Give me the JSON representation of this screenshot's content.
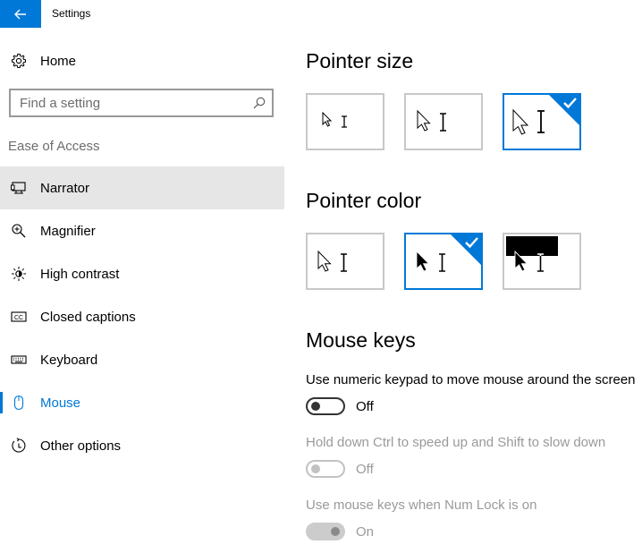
{
  "window": {
    "title": "Settings"
  },
  "colors": {
    "accent": "#0078d7",
    "hover_bg": "#e6e6e6",
    "disabled_text": "#9a9a9a"
  },
  "sidebar": {
    "home_label": "Home",
    "home_icon": "gear-icon",
    "search_placeholder": "Find a setting",
    "search_icon": "search-icon",
    "section_label": "Ease of Access",
    "items": [
      {
        "label": "Narrator",
        "icon": "narrator-icon",
        "state": "hover"
      },
      {
        "label": "Magnifier",
        "icon": "magnifier-icon",
        "state": "normal"
      },
      {
        "label": "High contrast",
        "icon": "high-contrast-icon",
        "state": "normal"
      },
      {
        "label": "Closed captions",
        "icon": "closed-captions-icon",
        "state": "normal"
      },
      {
        "label": "Keyboard",
        "icon": "keyboard-icon",
        "state": "normal"
      },
      {
        "label": "Mouse",
        "icon": "mouse-icon",
        "state": "selected"
      },
      {
        "label": "Other options",
        "icon": "other-options-icon",
        "state": "normal"
      }
    ]
  },
  "main": {
    "pointer_size": {
      "heading": "Pointer size",
      "options": [
        {
          "name": "small",
          "selected": false
        },
        {
          "name": "medium",
          "selected": false
        },
        {
          "name": "large",
          "selected": true
        }
      ]
    },
    "pointer_color": {
      "heading": "Pointer color",
      "options": [
        {
          "name": "white",
          "selected": false
        },
        {
          "name": "black",
          "selected": true
        },
        {
          "name": "inverted",
          "selected": false
        }
      ]
    },
    "mouse_keys": {
      "heading": "Mouse keys",
      "settings": [
        {
          "label": "Use numeric keypad to move mouse around the screen",
          "state_text": "Off",
          "on": false,
          "enabled": true
        },
        {
          "label": "Hold down Ctrl to speed up and Shift to slow down",
          "state_text": "Off",
          "on": false,
          "enabled": false
        },
        {
          "label": "Use mouse keys when Num Lock is on",
          "state_text": "On",
          "on": true,
          "enabled": false
        }
      ]
    }
  }
}
